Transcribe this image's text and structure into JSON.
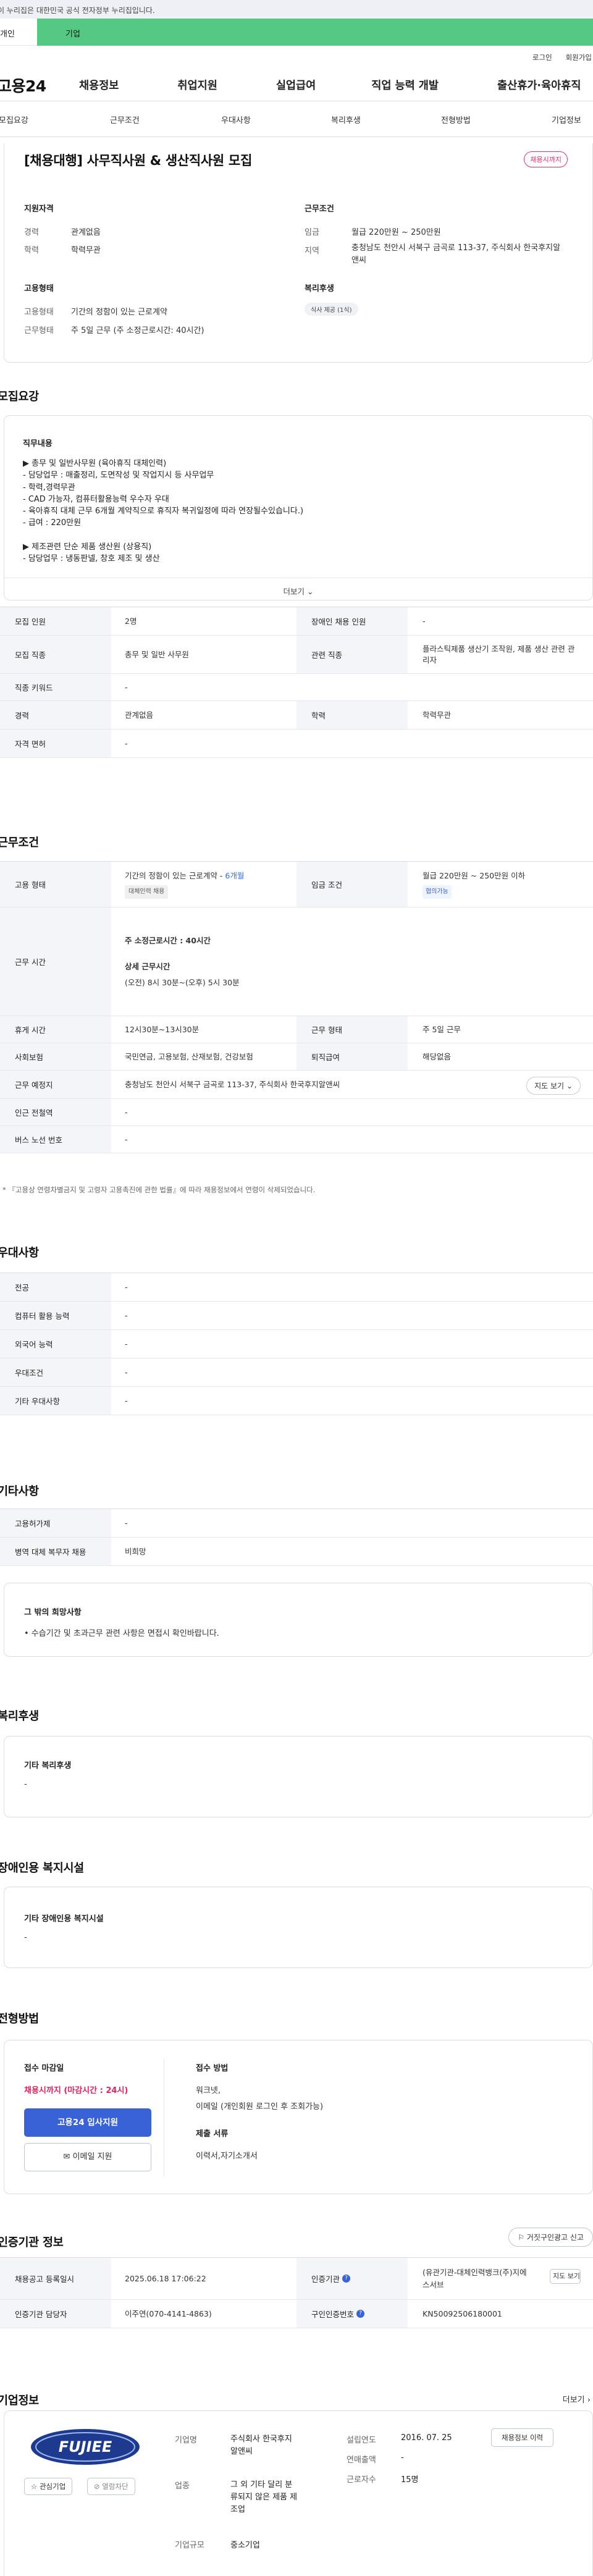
{
  "gov_banner": {
    "text": "이 누리집은 대한민국 공식 전자정부 누리집입니다."
  },
  "member_tabs": {
    "personal": "개인",
    "company": "기업"
  },
  "account": {
    "login": "로그인",
    "signup": "회원가입"
  },
  "logo": "고용24",
  "gnb": [
    "채용정보",
    "취업지원",
    "실업급여",
    "직업 능력 개발",
    "출산휴가·육아휴직"
  ],
  "subnav": [
    "모집요강",
    "근무조건",
    "우대사항",
    "복리후생",
    "전형방법",
    "기업정보"
  ],
  "summary": {
    "title": "[채용대행] 사무직사원 & 생산직사원 모집",
    "deadline_badge": "채용시까지",
    "qualification": {
      "label": "지원자격",
      "career_k": "경력",
      "career_v": "관계없음",
      "edu_k": "학력",
      "edu_v": "학력무관"
    },
    "conditions": {
      "label": "근무조건",
      "wage_k": "임금",
      "wage_v": "월급 220만원 ~ 250만원",
      "place_k": "지역",
      "place_v": "충청남도 천안시 서북구 금곡로 113-37, 주식회사 한국후지알앤씨"
    },
    "employment": {
      "label": "고용형태",
      "type_k": "고용형태",
      "type_v": "기간의 정함이 있는 근로계약",
      "hours_k": "근무형태",
      "hours_v": "주 5일 근무 (주 소정근로시간: 40시간)"
    },
    "welfare": {
      "label": "복리후생",
      "chip": "식사 제공 (1식)"
    }
  },
  "recruit": {
    "section_title": "모집요강",
    "desc_title": "직무내용",
    "desc_body": "▶ 총무 및 일반사무원 (육아휴직 대체인력)\n - 담당업무 : 매출정리, 도면작성 및 작업지시 등 사무업무\n - 학력,경력무관\n - CAD 가능자, 컴퓨터활용능력 우수자 우대\n - 육아휴직 대체 근무 6개월 계약직으로 휴직자 복귀일정에 따라 연장될수있습니다.)\n - 급여 : 220만원\n\n▶ 제조관련 단순 제품 생산원 (상용직)\n - 담당업무 : 냉동판넬, 창호 제조 및 생산",
    "more_label": "더보기",
    "rows": [
      {
        "k1": "모집 인원",
        "v1": "2명",
        "k2": "장애인 채용 인원",
        "v2": "-"
      },
      {
        "k1": "모집 직종",
        "v1": "총무 및 일반 사무원",
        "k2": "관련 직종",
        "v2": "플라스틱제품 생산기 조작원, 제품 생산 관련 관리자"
      },
      {
        "k1": "직종 키워드",
        "v1": "-"
      },
      {
        "k1": "경력",
        "v1": "관계없음",
        "k2": "학력",
        "v2": "학력무관"
      },
      {
        "k1": "자격 면허",
        "v1": "-"
      }
    ]
  },
  "work": {
    "section_title": "근무조건",
    "emp_k": "고용 형태",
    "emp_v": "기간의 정함이 있는 근로계약 -",
    "emp_period": "6개월",
    "emp_tag": "대체인력 채용",
    "wage_k": "임금 조건",
    "wage_v": "월급 220만원 ~ 250만원 이하",
    "wage_tag": "협의가능",
    "hours_k": "근무 시간",
    "hours_weekly": "주 소정근로시간 : 40시간",
    "hours_detail_label": "상세 근무시간",
    "hours_detail": "(오전) 8시 30분~(오후) 5시 30분",
    "break_k": "휴게 시간",
    "break_v": "12시30분~13시30분",
    "shift_k": "근무 형태",
    "shift_v": "주 5일 근무",
    "ins_k": "사회보험",
    "ins_v": "국민연금, 고용보험, 산재보험, 건강보험",
    "pension_k": "퇴직급여",
    "pension_v": "해당없음",
    "place_k": "근무 예정지",
    "place_v": "충청남도 천안시 서북구 금곡로 113-37, 주식회사 한국후지알앤씨",
    "map_btn": "지도 보기",
    "subway_k": "인근 전철역",
    "subway_v": "-",
    "bus_k": "버스 노선 번호",
    "bus_v": "-",
    "note": "* 『고용상 연령차별금지 및 고령자 고용촉진에 관한 법률』에 따라 채용정보에서 연령이 삭제되었습니다."
  },
  "preference": {
    "section_title": "우대사항",
    "rows": [
      {
        "k": "전공",
        "v": "-"
      },
      {
        "k": "컴퓨터 활용 능력",
        "v": "-"
      },
      {
        "k": "외국어 능력",
        "v": "-"
      },
      {
        "k": "우대조건",
        "v": "-"
      },
      {
        "k": "기타 우대사항",
        "v": "-"
      }
    ]
  },
  "etc": {
    "section_title": "기타사항",
    "rows": [
      {
        "k": "고용허가제",
        "v": "-"
      },
      {
        "k": "병역 대체 복무자 채용",
        "v": "비희망"
      }
    ],
    "box_title": "그 밖의 희망사항",
    "box_text": "• 수습기간 및 초과근무 관련 사항은 면접시 확인바랍니다."
  },
  "welfare": {
    "section_title": "복리후생",
    "box_title": "기타 복리후생",
    "box_text": "-"
  },
  "disability": {
    "section_title": "장애인용 복지시설",
    "box_title": "기타 장애인용 복지시설",
    "box_text": "-"
  },
  "selection": {
    "section_title": "전형방법",
    "deadline_label": "접수 마감일",
    "deadline_value": "채용시까지 (마감시간 : 24시)",
    "apply_btn": "고용24 입사지원",
    "email_btn": "이메일 지원",
    "method_label": "접수 방법",
    "method_values": [
      "워크넷,",
      "이메일 (개인회원 로그인 후 조회가능)"
    ],
    "docs_label": "제출 서류",
    "docs_value": "이력서,자기소개서"
  },
  "cert": {
    "section_title": "인증기관 정보",
    "report_btn": "거짓구인광고 신고",
    "reg_k": "채용공고 등록일시",
    "reg_v": "2025.06.18 17:06:22",
    "org_k": "인증기관",
    "org_v": "(유관기관-대체인력뱅크(주)지에스서브",
    "org_map": "지도 보기",
    "staff_k": "인증기관 담당자",
    "staff_v": "이주연(070-4141-4863)",
    "num_k": "구인인증번호",
    "num_v": "KN50092506180001"
  },
  "company": {
    "section_title": "기업정보",
    "more": "더보기",
    "logo_text": "FUJIEE",
    "fav_btn": "관심기업",
    "block_btn": "열람차단",
    "name_k": "기업명",
    "name_v": "주식회사 한국후지알앤씨",
    "industry_k": "업종",
    "industry_v": "그 외 기타 달리 분류되지 않은 제품 제조업",
    "scale_k": "기업규모",
    "scale_v": "중소기업",
    "founded_k": "설립연도",
    "founded_v": "2016. 07. 25",
    "sales_k": "연매출액",
    "sales_v": "-",
    "staff_k": "근로자수",
    "staff_v": "15명",
    "hire_btn": "채용정보 이력"
  }
}
